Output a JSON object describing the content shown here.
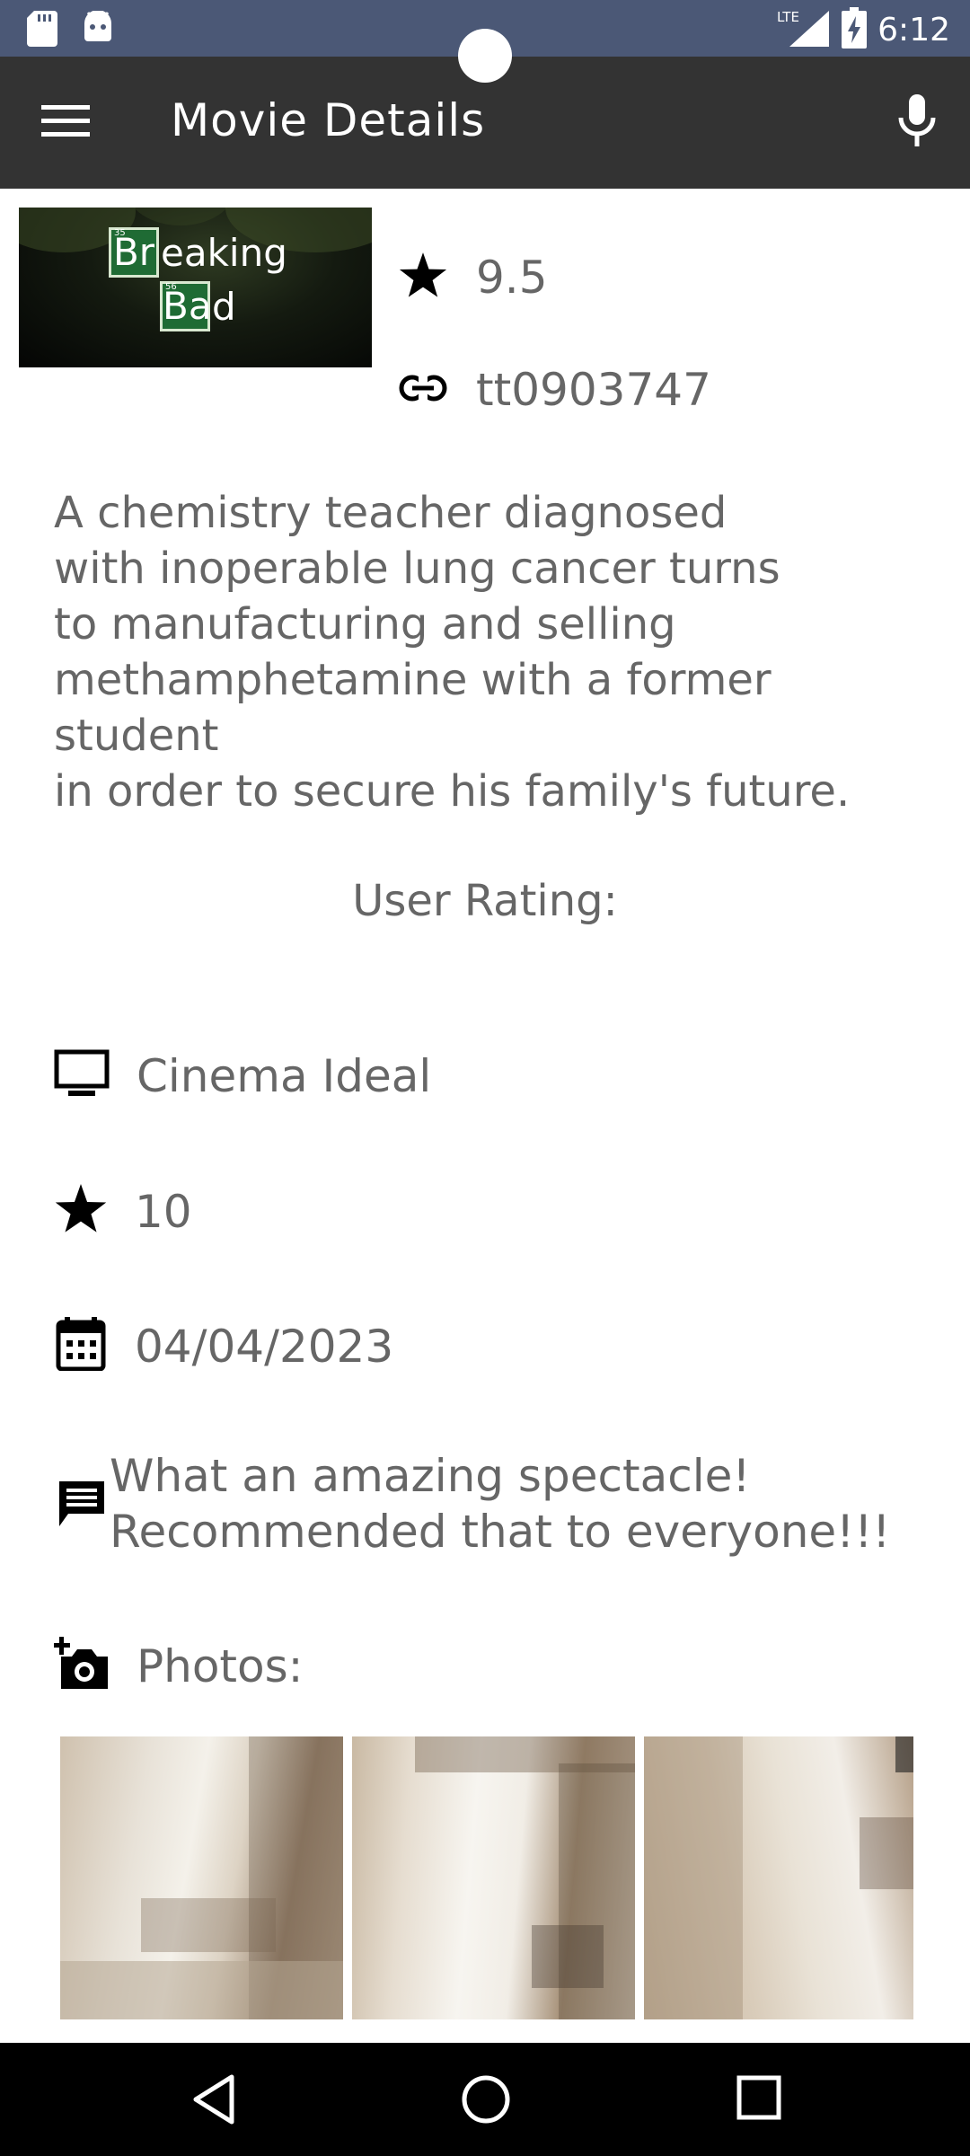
{
  "status_bar": {
    "time": "6:12",
    "network": "LTE",
    "icons": [
      "sd-card-icon",
      "android-icon",
      "signal-icon",
      "battery-charging-icon"
    ]
  },
  "app_bar": {
    "title": "Movie Details",
    "menu_icon": "menu-icon",
    "mic_icon": "mic-icon"
  },
  "movie": {
    "poster_logo": {
      "line1_symbol": "Br",
      "line1_symbol_number": "35",
      "line1_rest": "eaking",
      "line2_symbol": "Ba",
      "line2_symbol_number": "56",
      "line2_rest": "d"
    },
    "rating": "9.5",
    "imdb_id": "tt0903747",
    "description": "  A chemistry teacher diagnosed\nwith inoperable lung cancer turns\nto manufacturing and selling\nmethamphetamine with a former student\nin order to secure his family's future."
  },
  "user_rating": {
    "label": "User Rating:",
    "cinema": "Cinema Ideal",
    "score": "10",
    "date": "04/04/2023",
    "comment": "  What an amazing spectacle!\nRecommended that to everyone!!!",
    "photos_label": "Photos:"
  },
  "colors": {
    "status_bar": "#4b5876",
    "app_bar": "#333333",
    "text": "#666666",
    "nav_bar": "#000000",
    "logo_green": "#1f6b34"
  }
}
